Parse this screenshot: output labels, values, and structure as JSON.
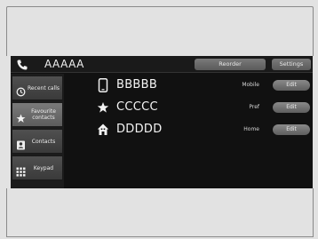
{
  "header": {
    "title": "AAAAA",
    "reorder_label": "Reorder",
    "settings_label": "Settings"
  },
  "sidebar": {
    "items": [
      {
        "label": "Recent calls",
        "icon": "recent-calls-icon",
        "active": false
      },
      {
        "label": "Favourite contacts",
        "icon": "star-icon",
        "active": true
      },
      {
        "label": "Contacts",
        "icon": "contacts-icon",
        "active": false
      },
      {
        "label": "Keypad",
        "icon": "keypad-icon",
        "active": false
      }
    ]
  },
  "favourites": [
    {
      "name": "BBBBB",
      "type": "Mobile",
      "icon": "mobile-phone-icon",
      "edit_label": "Edit"
    },
    {
      "name": "CCCCC",
      "type": "Pref",
      "icon": "star-icon",
      "edit_label": "Edit"
    },
    {
      "name": "DDDDD",
      "type": "Home",
      "icon": "home-icon",
      "edit_label": "Edit"
    }
  ]
}
